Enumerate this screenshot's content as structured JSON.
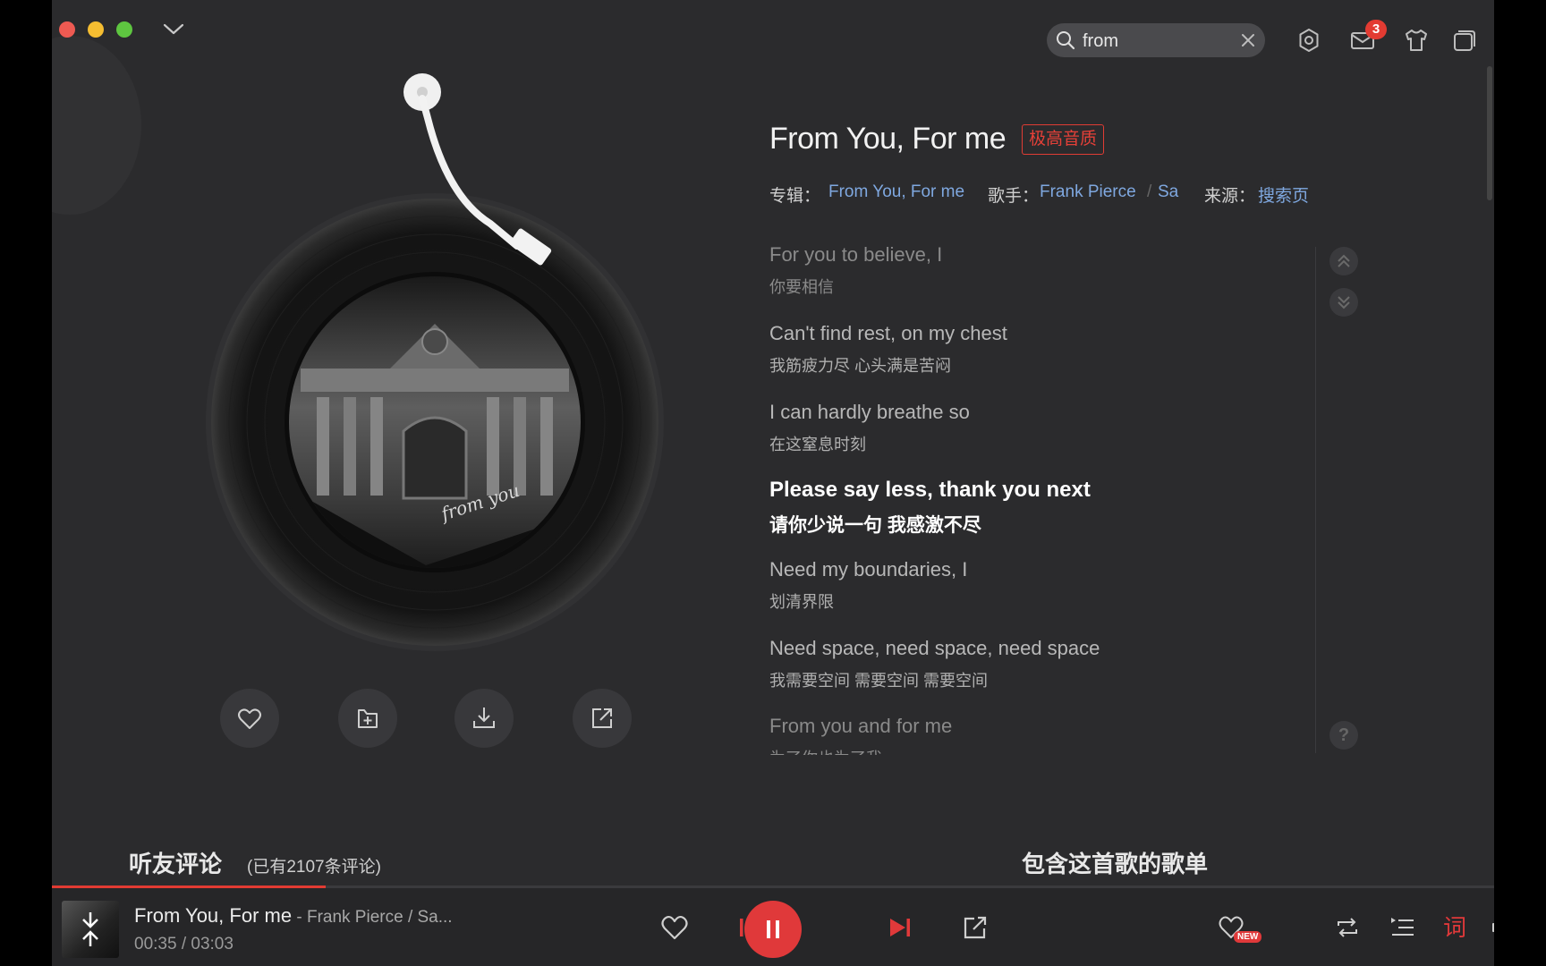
{
  "search": {
    "value": "from"
  },
  "header": {
    "mail_badge": "3"
  },
  "song": {
    "title": "From You, For me",
    "quality_badge": "极高音质",
    "album_label": "专辑：",
    "album": "From You, For me",
    "artist_label": "歌手：",
    "artists": [
      "Frank Pierce",
      "Sa"
    ],
    "source_label": "来源：",
    "source": "搜索页"
  },
  "lyrics": [
    {
      "en": "For you to believe, I",
      "zh": "你要相信"
    },
    {
      "en": "Can't find rest, on my chest",
      "zh": "我筋疲力尽 心头满是苦闷"
    },
    {
      "en": "I can hardly breathe so",
      "zh": "在这窒息时刻"
    },
    {
      "en": "Please say less, thank you next",
      "zh": "请你少说一句 我感激不尽"
    },
    {
      "en": "Need my boundaries, I",
      "zh": "划清界限"
    },
    {
      "en": "Need space, need space, need space",
      "zh": "我需要空间 需要空间 需要空间"
    },
    {
      "en": "From you and for me",
      "zh": "为了你也为了我"
    }
  ],
  "lyrics_active_index": 3,
  "sections": {
    "comments_title": "听友评论",
    "comments_count": "(已有2107条评论)",
    "playlists_title": "包含这首歌的歌单"
  },
  "player": {
    "title": "From You, For me",
    "artist": " - Frank Pierce / Sa...",
    "current_time": "00:35",
    "total_time": "/  03:03",
    "progress": 0.19,
    "new_badge": "NEW",
    "lyric_toggle": "词"
  },
  "colors": {
    "accent": "#e0393a",
    "link": "#7fa8e0",
    "background": "#2b2b2d"
  }
}
